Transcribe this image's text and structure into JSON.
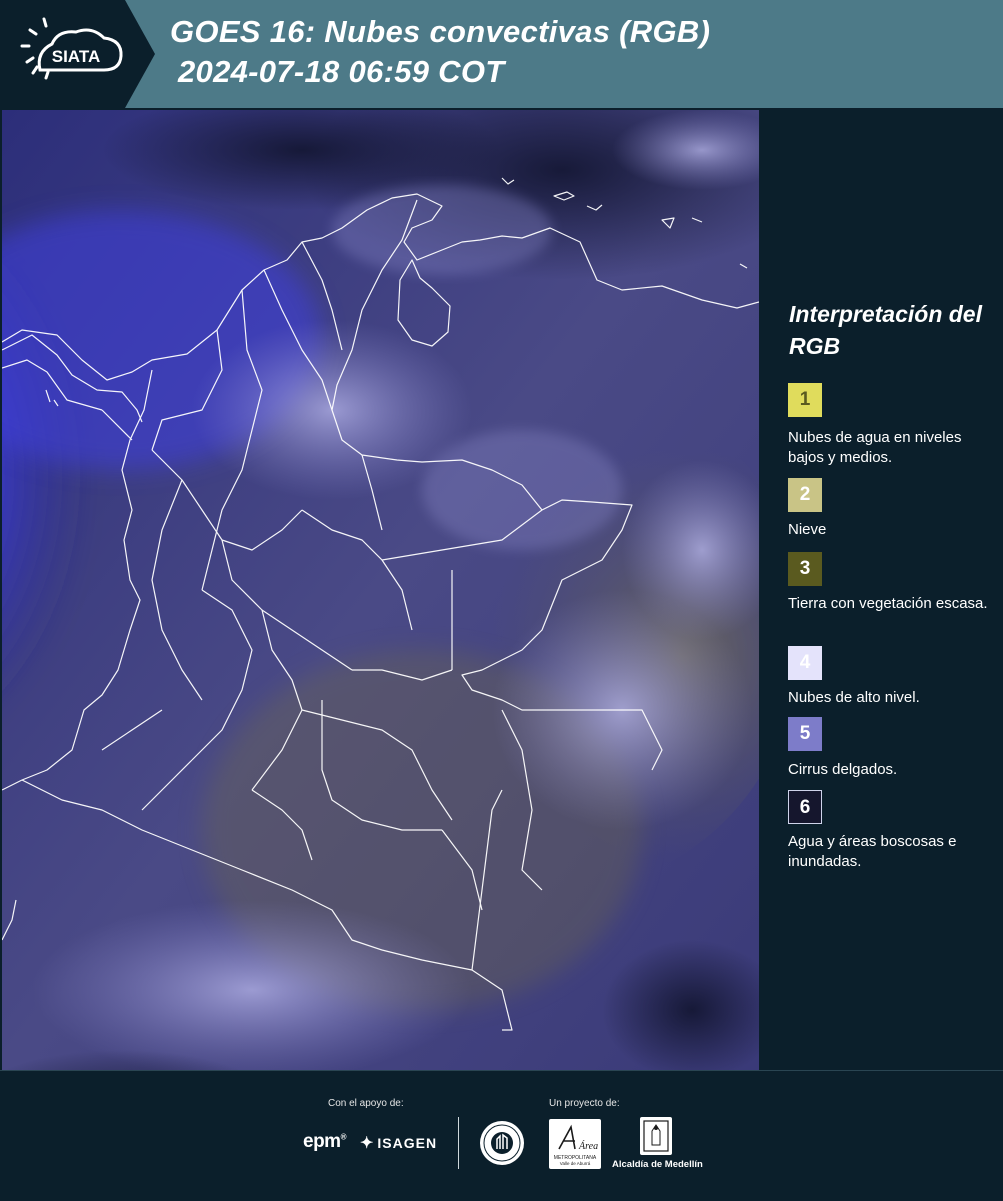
{
  "header": {
    "logo_text": "SIATA",
    "title_line1": "GOES 16: Nubes convectivas (RGB)",
    "title_line2": "2024-07-18 06:59 COT"
  },
  "legend": {
    "title": "Interpretación del RGB",
    "items": [
      {
        "number": "1",
        "color": "#e0dc5c",
        "text_color": "#5a5a20",
        "label": "Nubes de agua en niveles bajos y medios."
      },
      {
        "number": "2",
        "color": "#c9c486",
        "text_color": "#ffffff",
        "label": "Nieve"
      },
      {
        "number": "3",
        "color": "#5a5a1f",
        "text_color": "#ffffff",
        "label": "Tierra con vegetación escasa."
      },
      {
        "number": "4",
        "color": "#e4e3fb",
        "text_color": "#ffffff",
        "label": "Nubes de alto nivel."
      },
      {
        "number": "5",
        "color": "#7d7cc9",
        "text_color": "#ffffff",
        "label": "Cirrus delgados."
      },
      {
        "number": "6",
        "color": "#15162d",
        "text_color": "#ffffff",
        "label": "Agua y áreas boscosas e inundadas."
      }
    ]
  },
  "footer": {
    "support_caption": "Con el apoyo de:",
    "project_caption": "Un proyecto de:",
    "epm": "epm",
    "isagen": "ISAGEN",
    "area_name": "Área",
    "area_subtitle": "METROPOLITANA",
    "area_subtitle2": "Valle de Aburrá",
    "alcaldia": "Alcaldía de Medellín"
  },
  "colors": {
    "header_bg": "#4d7a88",
    "logo_bg": "#0b1f2b",
    "page_bg": "#0b1f2b",
    "ocean_blue": "#3b3be0",
    "cloud_lavender": "#9a98d8",
    "land_olive": "#6e6a3a",
    "dark_ocean": "#15163a",
    "border_lines": "#ffffff"
  }
}
